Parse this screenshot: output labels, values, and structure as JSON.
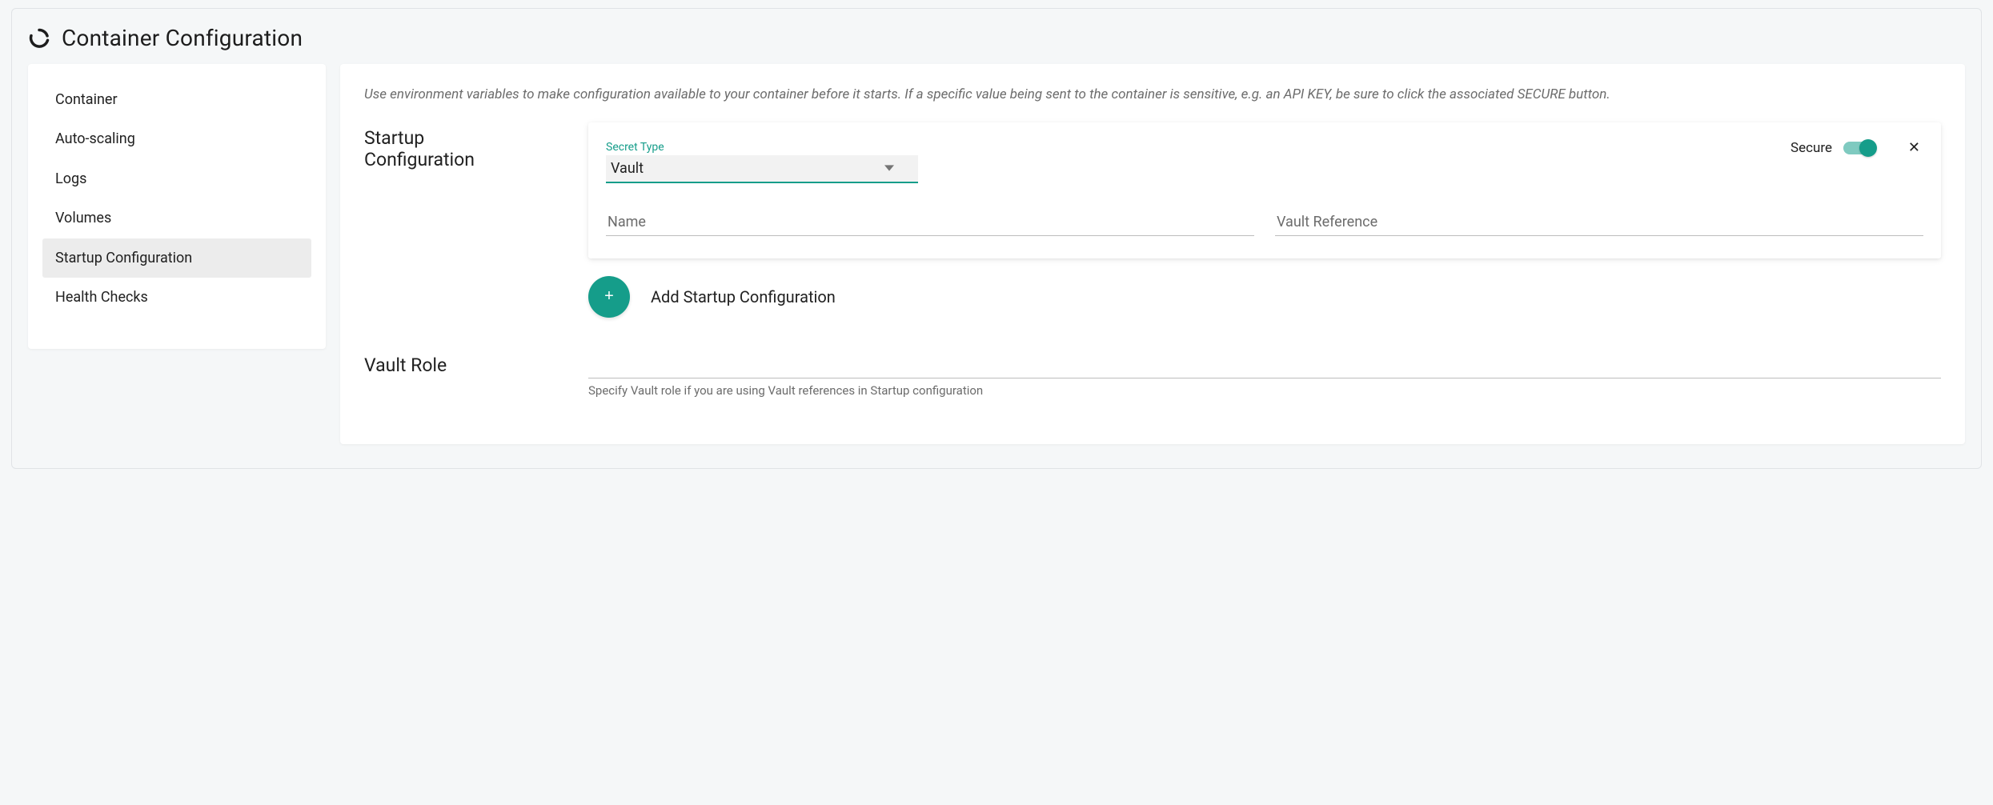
{
  "header": {
    "title": "Container Configuration",
    "icon": "progress-circle-icon"
  },
  "sidebar": {
    "items": [
      {
        "label": "Container"
      },
      {
        "label": "Auto-scaling"
      },
      {
        "label": "Logs"
      },
      {
        "label": "Volumes"
      },
      {
        "label": "Startup Configuration",
        "active": true
      },
      {
        "label": "Health Checks"
      }
    ]
  },
  "main": {
    "description": "Use environment variables to make configuration available to your container before it starts. If a specific value being sent to the container is sensitive, e.g. an API KEY, be sure to click the associated SECURE button.",
    "startup": {
      "section_label": "Startup Configuration",
      "card": {
        "secure_label": "Secure",
        "secure_on": true,
        "secret_type_label": "Secret Type",
        "secret_type_value": "Vault",
        "name_placeholder": "Name",
        "name_value": "",
        "vault_ref_placeholder": "Vault Reference",
        "vault_ref_value": ""
      },
      "add_label": "Add Startup Configuration"
    },
    "vault_role": {
      "section_label": "Vault Role",
      "value": "",
      "helper": "Specify Vault role if you are using Vault references in Startup configuration"
    }
  },
  "colors": {
    "accent": "#159d8a",
    "page_bg": "#f5f7f8",
    "card_bg": "#ffffff",
    "active_bg": "#ececec",
    "muted_text": "#6c6c6c"
  }
}
